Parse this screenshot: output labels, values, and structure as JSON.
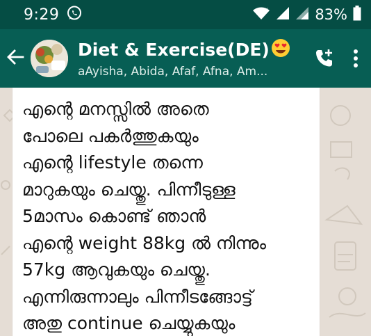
{
  "status_bar": {
    "time": "9:29",
    "battery": "83%",
    "app_icon": "whatsapp-icon",
    "icons": [
      "wifi-icon",
      "signal-icon",
      "signal-icon",
      "battery-icon"
    ]
  },
  "header": {
    "title": "Diet & Exercise(DE)",
    "title_emoji": "heart-eyes-emoji-icon",
    "members": "aAyisha, Abida, Afaf, Afna, Am...",
    "back_icon": "back-arrow-icon",
    "actions": [
      "add-call-icon",
      "more-vert-icon"
    ]
  },
  "message": {
    "lines": [
      "എന്റെ മനസ്സിൽ അതെ",
      "പോലെ പകർത്തുകയും",
      "എന്റെ lifestyle തന്നെ",
      "മാറുകയും ചെയ്തു. പിന്നീടുള്ള",
      "5മാസം കൊണ്ട് ഞാൻ",
      "എന്റെ weight 88kg ൽ നിന്നും",
      "57kg ആവുകയും ചെയ്തു.",
      "എന്നിരുന്നാലും പിന്നീടങ്ങോട്ട്",
      "അതു continue ചെയ്യുകയും"
    ]
  },
  "colors": {
    "status_bar": "#054d44",
    "app_bar": "#075e54",
    "chat_background": "#e5ddd5",
    "bubble": "#ffffff"
  }
}
